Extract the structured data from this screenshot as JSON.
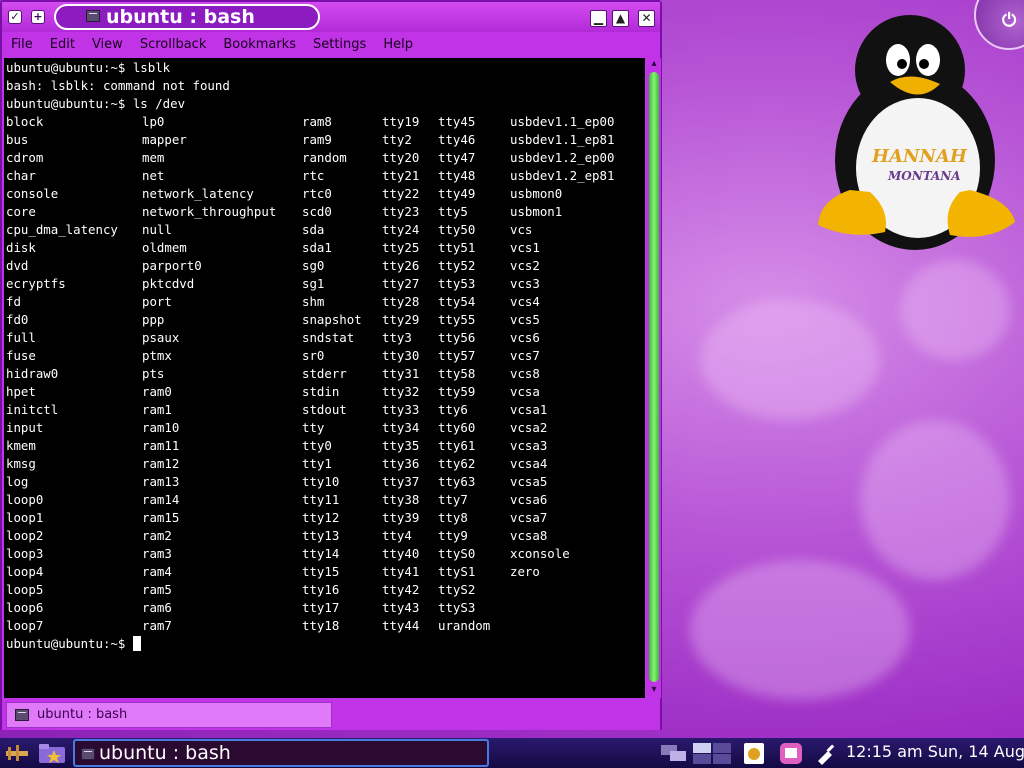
{
  "window": {
    "title": "ubuntu : bash",
    "menu": [
      "File",
      "Edit",
      "View",
      "Scrollback",
      "Bookmarks",
      "Settings",
      "Help"
    ],
    "controls": {
      "minimize": "▁",
      "maximize": "▲",
      "close": "✕"
    },
    "left_buttons": {
      "pin": "✓",
      "add": "+"
    },
    "tab_label": "ubuntu : bash"
  },
  "terminal": {
    "prompt_lines": [
      "ubuntu@ubuntu:~$ lsblk",
      "bash: lsblk: command not found",
      "ubuntu@ubuntu:~$ ls /dev"
    ],
    "listing": [
      [
        "block",
        "lp0",
        "ram8",
        "tty19",
        "tty45",
        "usbdev1.1_ep00"
      ],
      [
        "bus",
        "mapper",
        "ram9",
        "tty2",
        "tty46",
        "usbdev1.1_ep81"
      ],
      [
        "cdrom",
        "mem",
        "random",
        "tty20",
        "tty47",
        "usbdev1.2_ep00"
      ],
      [
        "char",
        "net",
        "rtc",
        "tty21",
        "tty48",
        "usbdev1.2_ep81"
      ],
      [
        "console",
        "network_latency",
        "rtc0",
        "tty22",
        "tty49",
        "usbmon0"
      ],
      [
        "core",
        "network_throughput",
        "scd0",
        "tty23",
        "tty5",
        "usbmon1"
      ],
      [
        "cpu_dma_latency",
        "null",
        "sda",
        "tty24",
        "tty50",
        "vcs"
      ],
      [
        "disk",
        "oldmem",
        "sda1",
        "tty25",
        "tty51",
        "vcs1"
      ],
      [
        "dvd",
        "parport0",
        "sg0",
        "tty26",
        "tty52",
        "vcs2"
      ],
      [
        "ecryptfs",
        "pktcdvd",
        "sg1",
        "tty27",
        "tty53",
        "vcs3"
      ],
      [
        "fd",
        "port",
        "shm",
        "tty28",
        "tty54",
        "vcs4"
      ],
      [
        "fd0",
        "ppp",
        "snapshot",
        "tty29",
        "tty55",
        "vcs5"
      ],
      [
        "full",
        "psaux",
        "sndstat",
        "tty3",
        "tty56",
        "vcs6"
      ],
      [
        "fuse",
        "ptmx",
        "sr0",
        "tty30",
        "tty57",
        "vcs7"
      ],
      [
        "hidraw0",
        "pts",
        "stderr",
        "tty31",
        "tty58",
        "vcs8"
      ],
      [
        "hpet",
        "ram0",
        "stdin",
        "tty32",
        "tty59",
        "vcsa"
      ],
      [
        "initctl",
        "ram1",
        "stdout",
        "tty33",
        "tty6",
        "vcsa1"
      ],
      [
        "input",
        "ram10",
        "tty",
        "tty34",
        "tty60",
        "vcsa2"
      ],
      [
        "kmem",
        "ram11",
        "tty0",
        "tty35",
        "tty61",
        "vcsa3"
      ],
      [
        "kmsg",
        "ram12",
        "tty1",
        "tty36",
        "tty62",
        "vcsa4"
      ],
      [
        "log",
        "ram13",
        "tty10",
        "tty37",
        "tty63",
        "vcsa5"
      ],
      [
        "loop0",
        "ram14",
        "tty11",
        "tty38",
        "tty7",
        "vcsa6"
      ],
      [
        "loop1",
        "ram15",
        "tty12",
        "tty39",
        "tty8",
        "vcsa7"
      ],
      [
        "loop2",
        "ram2",
        "tty13",
        "tty4",
        "tty9",
        "vcsa8"
      ],
      [
        "loop3",
        "ram3",
        "tty14",
        "tty40",
        "ttyS0",
        "xconsole"
      ],
      [
        "loop4",
        "ram4",
        "tty15",
        "tty41",
        "ttyS1",
        "zero"
      ],
      [
        "loop5",
        "ram5",
        "tty16",
        "tty42",
        "ttyS2",
        ""
      ],
      [
        "loop6",
        "ram6",
        "tty17",
        "tty43",
        "ttyS3",
        ""
      ],
      [
        "loop7",
        "ram7",
        "tty18",
        "tty44",
        "urandom",
        ""
      ]
    ],
    "final_prompt": "ubuntu@ubuntu:~$ "
  },
  "desktop": {
    "logo_text": [
      "HANNAH",
      "MONTANA"
    ],
    "knob_glyph": "⏻"
  },
  "taskbar": {
    "task_label": "ubuntu : bash",
    "clock": "12:15 am",
    "date": "Sun, 14 Aug"
  },
  "colors": {
    "window_purple": "#c033e6",
    "terminal_bg": "#000000",
    "scroll_green": "#2ec02a",
    "taskbar_blue": "#1e1258"
  }
}
